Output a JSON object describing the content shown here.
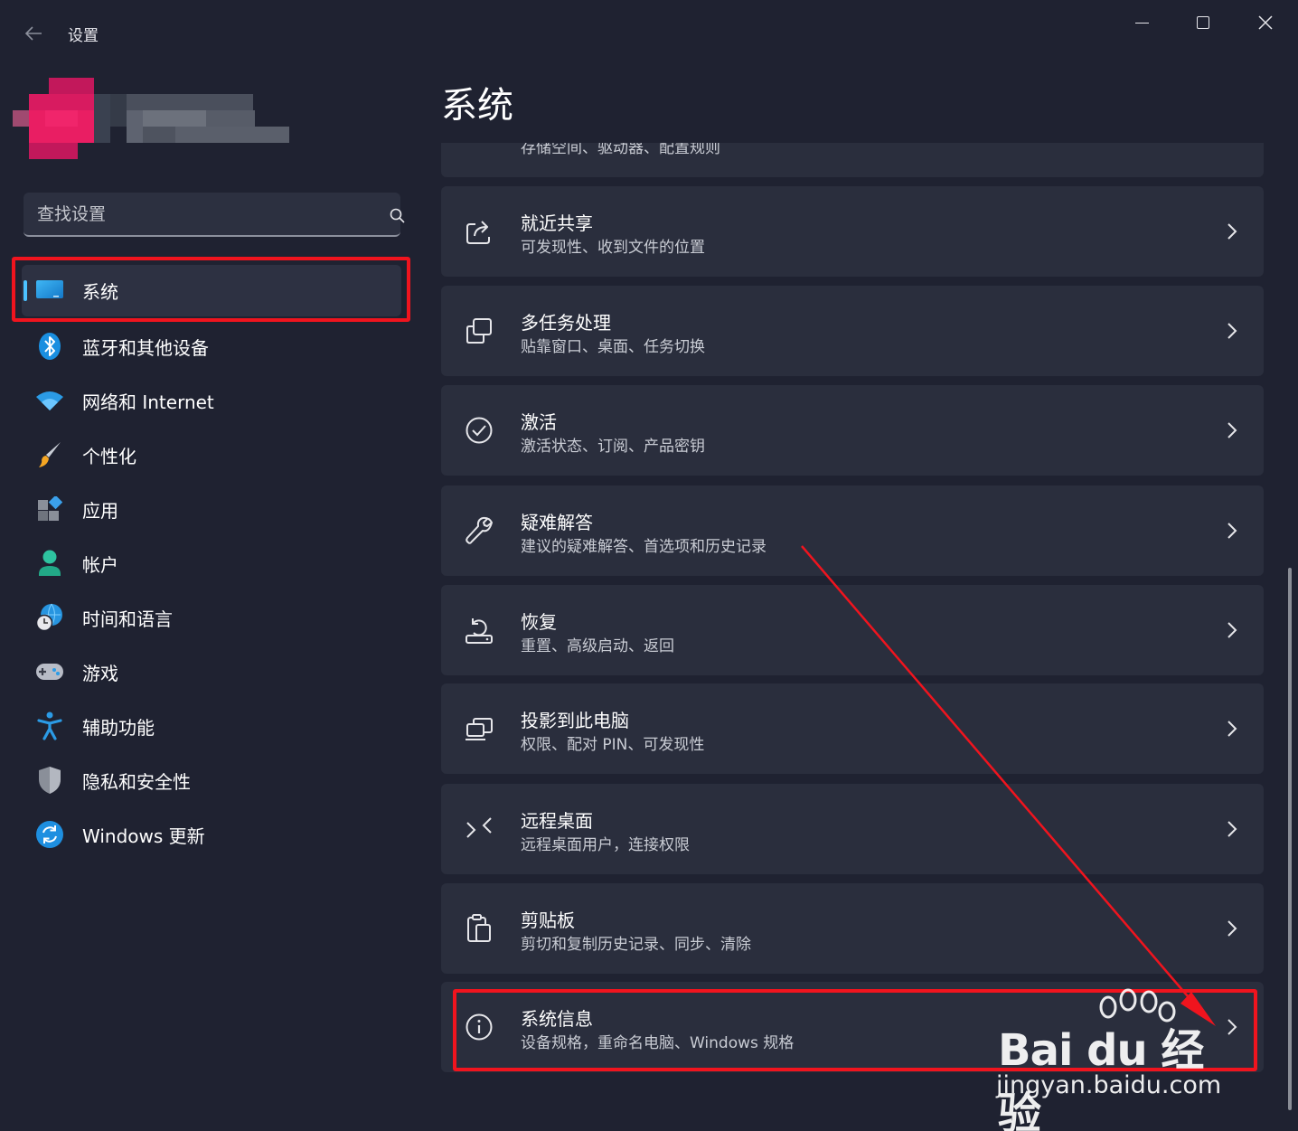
{
  "window": {
    "title": "设置",
    "back_label": "←"
  },
  "search": {
    "placeholder": "查找设置"
  },
  "sidebar": {
    "items": [
      {
        "label": "系统",
        "icon": "monitor-icon",
        "active": true
      },
      {
        "label": "蓝牙和其他设备",
        "icon": "bluetooth-icon"
      },
      {
        "label": "网络和 Internet",
        "icon": "wifi-icon"
      },
      {
        "label": "个性化",
        "icon": "paintbrush-icon"
      },
      {
        "label": "应用",
        "icon": "apps-icon"
      },
      {
        "label": "帐户",
        "icon": "person-icon"
      },
      {
        "label": "时间和语言",
        "icon": "globe-clock-icon"
      },
      {
        "label": "游戏",
        "icon": "gamepad-icon"
      },
      {
        "label": "辅助功能",
        "icon": "accessibility-icon"
      },
      {
        "label": "隐私和安全性",
        "icon": "shield-icon"
      },
      {
        "label": "Windows 更新",
        "icon": "update-icon"
      }
    ]
  },
  "main": {
    "title": "系统",
    "partial_card": {
      "subtitle": "存储空间、驱动器、配置规则"
    },
    "cards": [
      {
        "title": "就近共享",
        "subtitle": "可发现性、收到文件的位置",
        "icon": "share-icon"
      },
      {
        "title": "多任务处理",
        "subtitle": "贴靠窗口、桌面、任务切换",
        "icon": "multitask-icon"
      },
      {
        "title": "激活",
        "subtitle": "激活状态、订阅、产品密钥",
        "icon": "check-circle-icon"
      },
      {
        "title": "疑难解答",
        "subtitle": "建议的疑难解答、首选项和历史记录",
        "icon": "wrench-icon"
      },
      {
        "title": "恢复",
        "subtitle": "重置、高级启动、返回",
        "icon": "recovery-icon"
      },
      {
        "title": "投影到此电脑",
        "subtitle": "权限、配对 PIN、可发现性",
        "icon": "project-icon"
      },
      {
        "title": "远程桌面",
        "subtitle": "远程桌面用户，连接权限",
        "icon": "remote-desktop-icon"
      },
      {
        "title": "剪贴板",
        "subtitle": "剪切和复制历史记录、同步、清除",
        "icon": "clipboard-icon"
      },
      {
        "title": "系统信息",
        "subtitle": "设备规格，重命名电脑、Windows 规格",
        "icon": "info-icon"
      }
    ]
  },
  "watermark": {
    "brand": "Bai du 经验",
    "url": "jingyan.baidu.com"
  },
  "colors": {
    "background": "#1f2231",
    "card": "#2a2e3d",
    "accent": "#4cc2ff",
    "annotation": "#f0141e"
  }
}
